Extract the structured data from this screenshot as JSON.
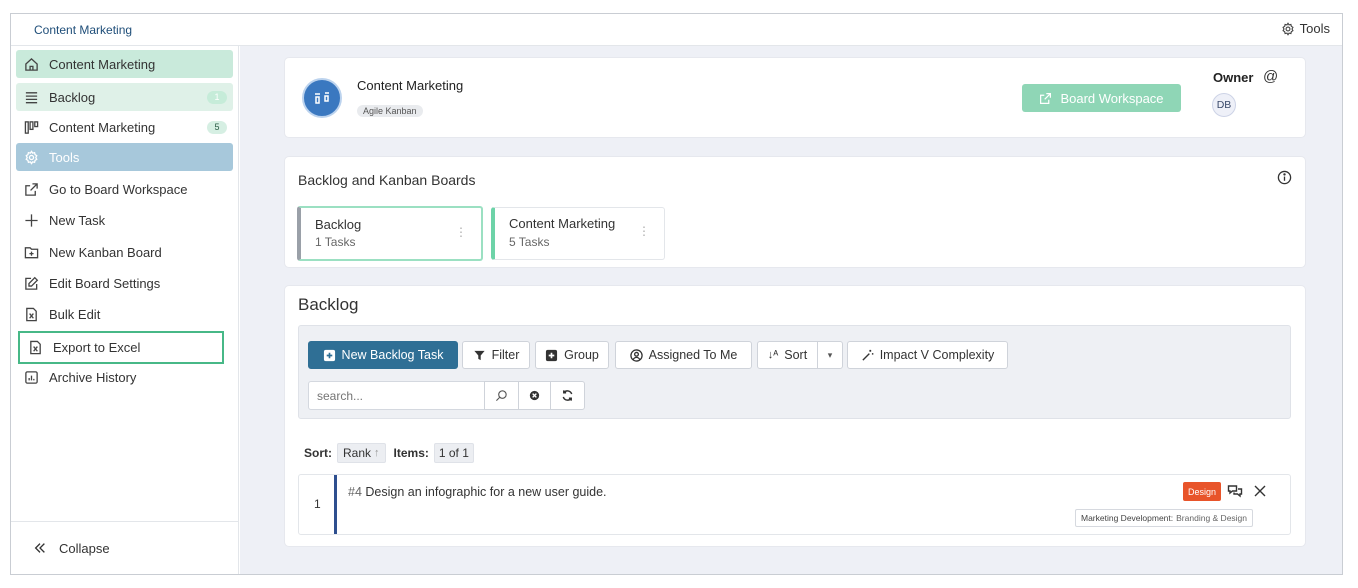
{
  "topbar": {
    "app_title": "Content Marketing",
    "tools_label": "Tools"
  },
  "sidebar": {
    "items": [
      {
        "label": "Content Marketing",
        "icon": "home-icon",
        "state": "active"
      },
      {
        "label": "Backlog",
        "icon": "list-icon",
        "badge": "1",
        "state": "highlight"
      },
      {
        "label": "Content Marketing",
        "icon": "kanban-icon",
        "badge": "5"
      },
      {
        "label": "Tools",
        "icon": "gear-icon",
        "state": "section"
      },
      {
        "label": "Go to Board Workspace",
        "icon": "external-link-icon"
      },
      {
        "label": "New Task",
        "icon": "plus-icon"
      },
      {
        "label": "New Kanban Board",
        "icon": "add-board-icon"
      },
      {
        "label": "Edit Board Settings",
        "icon": "edit-icon"
      },
      {
        "label": "Bulk Edit",
        "icon": "excel-file-icon"
      },
      {
        "label": "Export to Excel",
        "icon": "excel-file-icon",
        "state": "outlined"
      },
      {
        "label": "Archive History",
        "icon": "chart-icon"
      }
    ],
    "collapse_label": "Collapse"
  },
  "header": {
    "board_name": "Content Marketing",
    "board_type": "Agile Kanban",
    "workspace_button": "Board Workspace",
    "owner_label": "Owner",
    "owner_initials": "DB",
    "mention_symbol": "@"
  },
  "boards_section": {
    "title": "Backlog and Kanban Boards",
    "boards": [
      {
        "name": "Backlog",
        "count": "1 Tasks",
        "color": "#9aa0a8"
      },
      {
        "name": "Content Marketing",
        "count": "5 Tasks",
        "color": "#6dd3a8"
      }
    ]
  },
  "backlog": {
    "title": "Backlog",
    "toolbar": {
      "new_task": "New Backlog Task",
      "filter": "Filter",
      "group": "Group",
      "assigned": "Assigned To Me",
      "sort": "Sort",
      "impact": "Impact V Complexity"
    },
    "search": {
      "placeholder": "search..."
    },
    "sort_label": "Sort:",
    "sort_value": "Rank",
    "items_label": "Items:",
    "items_value": "1 of 1",
    "tasks": [
      {
        "row": "1",
        "id": "#4",
        "title": "Design an infographic for a new user guide.",
        "tag": "Design",
        "category_label": "Marketing Development:",
        "category_value": "Branding & Design"
      }
    ]
  },
  "colors": {
    "accent": "#2f6f95",
    "active_nav": "#c9eadb",
    "section_nav": "#a7c8db",
    "workspace_button": "#8fd6b6",
    "tag": "#e8542a",
    "outline": "#47b887"
  }
}
